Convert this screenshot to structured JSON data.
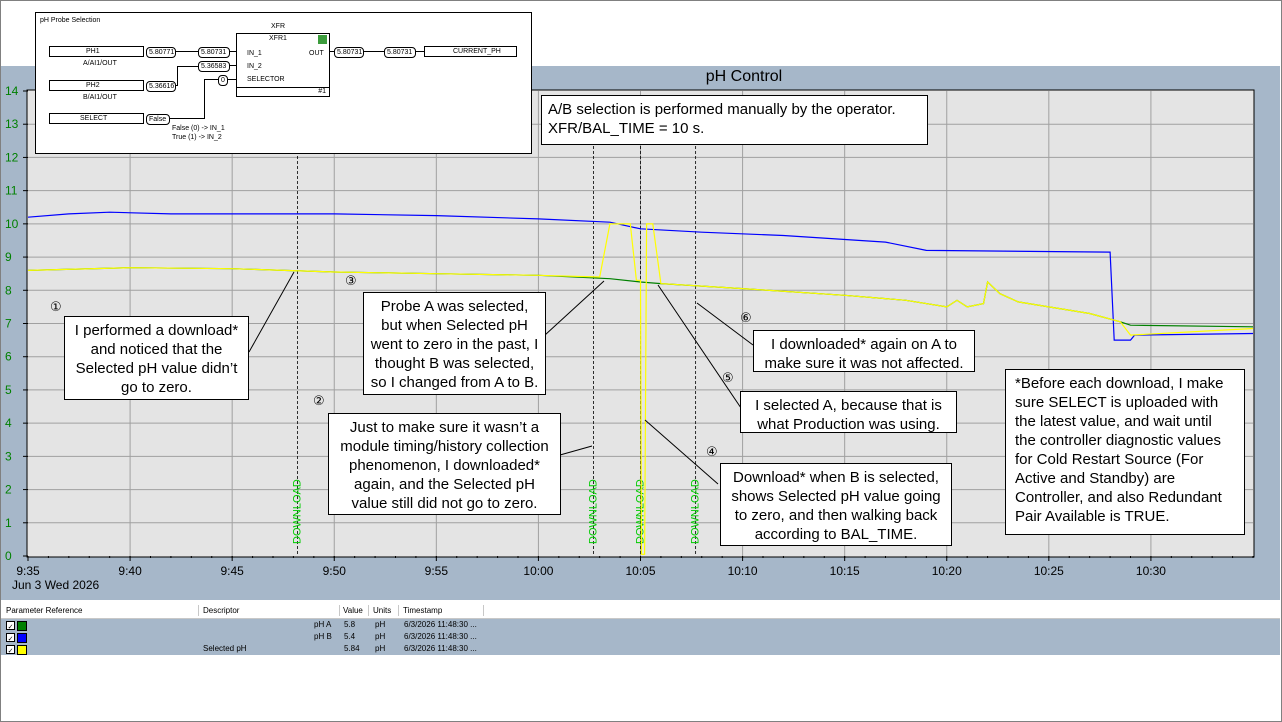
{
  "chart_data": {
    "type": "line",
    "title": "pH Control",
    "date_label": "Jun 3 Wed 2026",
    "x_ticks": [
      "9:35",
      "9:40",
      "9:45",
      "9:50",
      "9:55",
      "10:00",
      "10:05",
      "10:10",
      "10:15",
      "10:20",
      "10:25",
      "10:30"
    ],
    "x_range": [
      "9:35",
      "10:35"
    ],
    "y_ticks": [
      0,
      1,
      2,
      3,
      4,
      5,
      6,
      7,
      8,
      9,
      10,
      11,
      12,
      13,
      14
    ],
    "ylim": [
      0,
      14
    ],
    "grid": true,
    "series": [
      {
        "name": "pH A",
        "color": "#008000",
        "points": [
          [
            "9:35",
            8.6
          ],
          [
            "9:40",
            8.68
          ],
          [
            "9:45",
            8.65
          ],
          [
            "9:50",
            8.55
          ],
          [
            "9:55",
            8.5
          ],
          [
            "10:00",
            8.45
          ],
          [
            "10:03.5",
            8.35
          ],
          [
            "10:05",
            8.25
          ],
          [
            "10:06",
            8.2
          ],
          [
            "10:10",
            8.05
          ],
          [
            "10:15",
            7.85
          ],
          [
            "10:18",
            7.7
          ],
          [
            "10:20",
            7.5
          ],
          [
            "10:20.5",
            7.7
          ],
          [
            "10:21",
            7.5
          ],
          [
            "10:21.8",
            7.6
          ],
          [
            "10:22",
            8.25
          ],
          [
            "10:22.6",
            7.9
          ],
          [
            "10:23.5",
            7.65
          ],
          [
            "10:25",
            7.5
          ],
          [
            "10:27",
            7.3
          ],
          [
            "10:28.5",
            7.05
          ],
          [
            "10:29",
            6.95
          ],
          [
            "10:35",
            6.9
          ]
        ]
      },
      {
        "name": "pH B",
        "color": "#0000ff",
        "points": [
          [
            "9:35",
            10.2
          ],
          [
            "9:37",
            10.3
          ],
          [
            "9:39",
            10.35
          ],
          [
            "9:42",
            10.3
          ],
          [
            "9:45",
            10.3
          ],
          [
            "9:50",
            10.3
          ],
          [
            "9:55",
            10.25
          ],
          [
            "10:00",
            10.15
          ],
          [
            "10:03.5",
            10.05
          ],
          [
            "10:05",
            9.85
          ],
          [
            "10:08",
            9.75
          ],
          [
            "10:12",
            9.65
          ],
          [
            "10:17",
            9.45
          ],
          [
            "10:19",
            9.2
          ],
          [
            "10:28",
            9.15
          ],
          [
            "10:28.2",
            6.5
          ],
          [
            "10:29",
            6.5
          ],
          [
            "10:29.2",
            6.65
          ],
          [
            "10:35",
            6.7
          ]
        ]
      },
      {
        "name": "Selected pH",
        "color": "#ffff00",
        "points": [
          [
            "9:35",
            8.6
          ],
          [
            "9:40",
            8.68
          ],
          [
            "9:45",
            8.65
          ],
          [
            "9:50",
            8.55
          ],
          [
            "9:55",
            8.5
          ],
          [
            "10:00",
            8.45
          ],
          [
            "10:03",
            8.4
          ],
          [
            "10:03.5",
            10.0
          ],
          [
            "10:04.5",
            10.0
          ],
          [
            "10:04.8",
            8.3
          ],
          [
            "10:05",
            8.3
          ],
          [
            "10:05.05",
            0.05
          ],
          [
            "10:05.2",
            0.05
          ],
          [
            "10:05.3",
            10.0
          ],
          [
            "10:05.6",
            10.0
          ],
          [
            "10:06",
            8.2
          ],
          [
            "10:10",
            8.05
          ],
          [
            "10:15",
            7.85
          ],
          [
            "10:18",
            7.7
          ],
          [
            "10:20",
            7.5
          ],
          [
            "10:20.5",
            7.7
          ],
          [
            "10:21",
            7.5
          ],
          [
            "10:21.8",
            7.6
          ],
          [
            "10:22",
            8.25
          ],
          [
            "10:22.6",
            7.9
          ],
          [
            "10:23.5",
            7.65
          ],
          [
            "10:25",
            7.5
          ],
          [
            "10:27",
            7.3
          ],
          [
            "10:28.5",
            7.05
          ],
          [
            "10:29",
            6.65
          ],
          [
            "10:35",
            6.85
          ]
        ]
      }
    ],
    "event_markers": [
      {
        "time": "9:48.2",
        "label": "DOWNLOAD"
      },
      {
        "time": "10:02.7",
        "label": "DOWNLOAD"
      },
      {
        "time": "10:05",
        "label": "DOWNLOAD"
      },
      {
        "time": "10:07.7",
        "label": "DOWNLOAD"
      }
    ]
  },
  "function_block": {
    "title": "pH Probe Selection",
    "block_type": "XFR",
    "block_name": "XFR1",
    "block_index": "#1",
    "inputs": [
      {
        "name": "PH1",
        "path": "A/AI1/OUT",
        "value": "5.80771",
        "wire_value": "5.80731",
        "pin": "IN_1"
      },
      {
        "name": "PH2",
        "path": "B/AI1/OUT",
        "value": "5.36616",
        "wire_value": "5.36583",
        "pin": "IN_2"
      },
      {
        "name": "SELECT",
        "path": "",
        "value": "False",
        "wire_value": "0",
        "pin": "SELECTOR"
      }
    ],
    "out_pin": "OUT",
    "out_value": "5.80731",
    "out_wire_value": "5.80731",
    "output_name": "CURRENT_PH",
    "note_false": "False (0) -> IN_1",
    "note_true": "True (1) -> IN_2"
  },
  "annotations": {
    "top_note": [
      "A/B selection is performed manually by the operator.",
      "XFR/BAL_TIME = 10 s."
    ],
    "n1": {
      "num": "①",
      "lines": [
        "I performed a download*",
        "and noticed that the",
        "Selected pH value didn’t",
        "go to zero."
      ]
    },
    "n2": {
      "num": "②",
      "lines": [
        "Just to make sure it wasn’t a",
        "module timing/history collection",
        "phenomenon, I downloaded*",
        "again, and the Selected pH",
        "value still did not go to zero."
      ]
    },
    "n3": {
      "num": "③",
      "lines": [
        "Probe A was selected,",
        "but when Selected pH",
        "went to zero in the past, I",
        "thought B was selected,",
        "so I changed from A to B."
      ]
    },
    "n4": {
      "num": "④",
      "lines": [
        "Download* when B is selected,",
        "shows Selected pH value going",
        "to zero, and then walking back",
        "according to BAL_TIME."
      ]
    },
    "n5": {
      "num": "⑤",
      "lines": [
        "I selected A, because that is",
        "what Production was using."
      ]
    },
    "n6": {
      "num": "⑥",
      "lines": [
        "I downloaded* again on A to",
        "make sure it was not affected."
      ]
    },
    "footnote": [
      "*Before each download, I make",
      "sure SELECT is uploaded with",
      "the latest value, and wait until",
      "the controller diagnostic values",
      "for Cold Restart Source (For",
      "Active and Standby) are",
      "Controller, and also Redundant",
      "Pair Available is TRUE."
    ]
  },
  "table": {
    "headers": [
      "Parameter Reference",
      "Descriptor",
      "Value",
      "Units",
      "Timestamp"
    ],
    "rows": [
      {
        "param": "pH A",
        "descriptor": "",
        "value": "5.8",
        "units": "pH",
        "timestamp": "6/3/2026 11:48:30 ...",
        "color": "#008000",
        "checked": "✓"
      },
      {
        "param": "pH B",
        "descriptor": "",
        "value": "5.4",
        "units": "pH",
        "timestamp": "6/3/2026 11:48:30 ...",
        "color": "#0000ff",
        "checked": "✓"
      },
      {
        "param": "",
        "descriptor": "Selected pH",
        "value": "5.84",
        "units": "pH",
        "timestamp": "6/3/2026 11:48:30 ...",
        "color": "#ffff00",
        "checked": "✓"
      }
    ]
  },
  "colors": {
    "panel": "#a6b7c9",
    "plot_bg": "#e4e4e4",
    "axis_text": "#008000",
    "marker": "#00cc00"
  }
}
